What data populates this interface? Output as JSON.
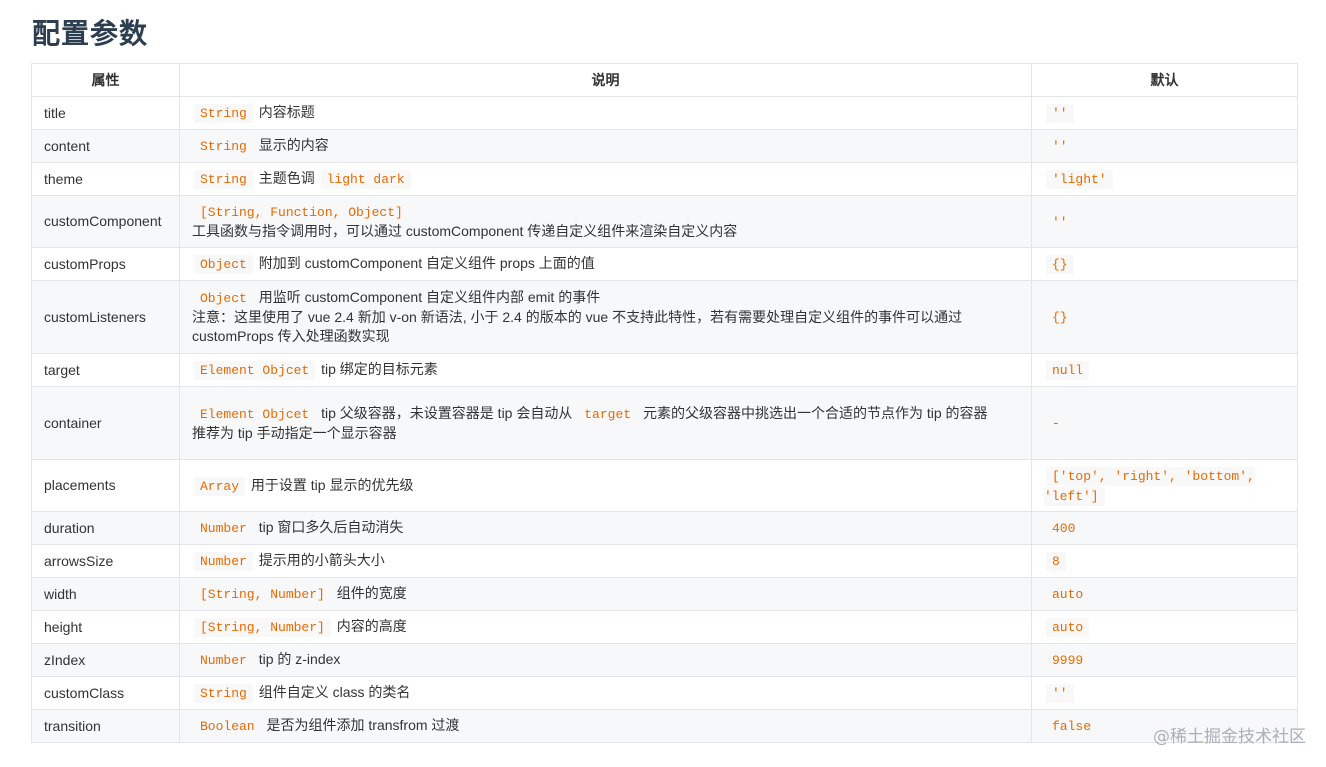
{
  "title": "配置参数",
  "headers": [
    "属性",
    "说明",
    "默认"
  ],
  "rows": [
    {
      "prop": "title",
      "type": "String",
      "desc": "内容标题",
      "def": "''"
    },
    {
      "prop": "content",
      "type": "String",
      "desc": "显示的内容",
      "def": "''"
    },
    {
      "prop": "theme",
      "type": "String",
      "desc": "主题色调",
      "desc_code": "light dark",
      "def": "'light'"
    },
    {
      "prop": "customComponent",
      "type": "[String, Function, Object]",
      "desc2": "工具函数与指令调用时，可以通过 customComponent 传递自定义组件来渲染自定义内容",
      "def": "''"
    },
    {
      "prop": "customProps",
      "type": "Object",
      "desc": "附加到 customComponent 自定义组件 props 上面的值",
      "def": "{}"
    },
    {
      "prop": "customListeners",
      "type": "Object",
      "desc": "用监听 customComponent 自定义组件内部 emit 的事件",
      "desc2": "注意：这里使用了 vue 2.4 新加 v-on 新语法, 小于 2.4 的版本的 vue 不支持此特性，若有需要处理自定义组件的事件可以通过 customProps 传入处理函数实现",
      "def": "{}"
    },
    {
      "prop": "target",
      "type": "Element Objcet",
      "desc": "tip 绑定的目标元素",
      "def": "null"
    },
    {
      "prop": "container",
      "type": "Element Objcet",
      "desc": "tip 父级容器，未设置容器是 tip 会自动从",
      "desc_code": "target",
      "desc_after": "元素的父级容器中挑选出一个合适的节点作为 tip 的容器",
      "desc2": "推荐为 tip 手动指定一个显示容器",
      "def": "-"
    },
    {
      "prop": "placements",
      "type": "Array",
      "desc": "用于设置 tip 显示的优先级",
      "def": "['top', 'right', 'bottom', 'left']"
    },
    {
      "prop": "duration",
      "type": "Number",
      "desc": "tip 窗口多久后自动消失",
      "def": "400"
    },
    {
      "prop": "arrowsSize",
      "type": "Number",
      "desc": "提示用的小箭头大小",
      "def": "8"
    },
    {
      "prop": "width",
      "type": "[String, Number]",
      "desc": "组件的宽度",
      "def": "auto"
    },
    {
      "prop": "height",
      "type": "[String, Number]",
      "desc": "内容的高度",
      "def": "auto"
    },
    {
      "prop": "zIndex",
      "type": "Number",
      "desc": "tip 的 z-index",
      "def": "9999"
    },
    {
      "prop": "customClass",
      "type": "String",
      "desc": "组件自定义 class 的类名",
      "def": "''"
    },
    {
      "prop": "transition",
      "type": "Boolean",
      "desc": "是否为组件添加 transfrom 过渡",
      "def": "false"
    }
  ],
  "watermark": "@稀土掘金技术社区"
}
